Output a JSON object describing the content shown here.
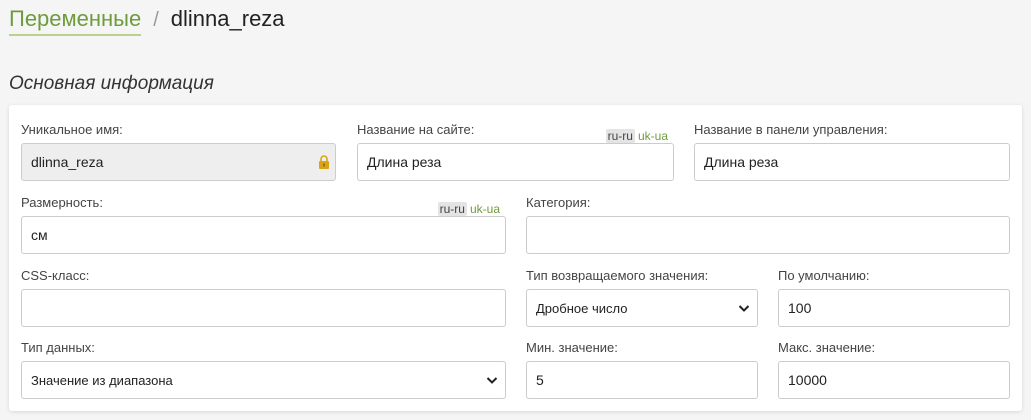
{
  "breadcrumb": {
    "parent": "Переменные",
    "separator": "/",
    "current": "dlinna_reza"
  },
  "section_title": "Основная информация",
  "colors": {
    "accent": "#6e9c3d",
    "underline": "#b8d28f"
  },
  "fields": {
    "unique_name": {
      "label": "Уникальное имя:",
      "value": "dlinna_reza",
      "icon": "lock-icon"
    },
    "site_name": {
      "label": "Название на сайте:",
      "value": "Длина реза",
      "lang_active": "ru-ru",
      "lang_other": "uk-ua"
    },
    "admin_name": {
      "label": "Название в панели управления:",
      "value": "Длина реза"
    },
    "dimension": {
      "label": "Размерность:",
      "value": "см",
      "lang_active": "ru-ru",
      "lang_other": "uk-ua"
    },
    "category": {
      "label": "Категория:",
      "value": ""
    },
    "css_class": {
      "label": "CSS-класс:",
      "value": ""
    },
    "return_type": {
      "label": "Тип возвращаемого значения:",
      "value": "Дробное число"
    },
    "default": {
      "label": "По умолчанию:",
      "value": "100"
    },
    "data_type": {
      "label": "Тип данных:",
      "value": "Значение из диапазона"
    },
    "min_value": {
      "label": "Мин. значение:",
      "value": "5"
    },
    "max_value": {
      "label": "Макс. значение:",
      "value": "10000"
    }
  }
}
